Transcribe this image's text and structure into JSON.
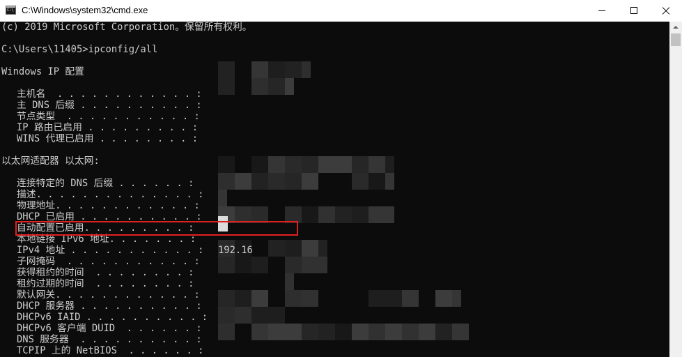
{
  "window": {
    "title": "C:\\Windows\\system32\\cmd.exe"
  },
  "console": {
    "copyright": "(c) 2019 Microsoft Corporation。保留所有权利。",
    "prompt": "C:\\Users\\11405>ipconfig/all",
    "ip_config_header": "Windows IP 配置",
    "global": [
      {
        "label": "主机名  . . . . . . . . . . . . :"
      },
      {
        "label": "主 DNS 后缀 . . . . . . . . . . :"
      },
      {
        "label": "节点类型  . . . . . . . . . . . :"
      },
      {
        "label": "IP 路由已启用 . . . . . . . . . :"
      },
      {
        "label": "WINS 代理已启用 . . . . . . . . :"
      }
    ],
    "adapter_header": "以太网适配器 以太网:",
    "adapter": [
      {
        "label": "连接特定的 DNS 后缀 . . . . . . :"
      },
      {
        "label": "描述. . . . . . . . . . . . . . :"
      },
      {
        "label": "物理地址. . . . . . . . . . . . :"
      },
      {
        "label": "DHCP 已启用 . . . . . . . . . . :"
      },
      {
        "label": "自动配置已启用. . . . . . . . . :"
      },
      {
        "label": "本地链接 IPv6 地址. . . . . . . :"
      },
      {
        "label": "IPv4 地址 . . . . . . . . . . . :"
      },
      {
        "label": "子网掩码  . . . . . . . . . . . :"
      },
      {
        "label": "获得租约的时间  . . . . . . . . :"
      },
      {
        "label": "租约过期的时间  . . . . . . . . :"
      },
      {
        "label": "默认网关. . . . . . . . . . . . :"
      },
      {
        "label": "DHCP 服务器 . . . . . . . . . . :"
      },
      {
        "label": "DHCPv6 IAID . . . . . . . . . . :"
      },
      {
        "label": "DHCPv6 客户端 DUID  . . . . . . :"
      },
      {
        "label": "DNS 服务器  . . . . . . . . . . :"
      },
      {
        "label": "TCPIP 上的 NetBIOS  . . . . . . :"
      }
    ],
    "ipv4_value": "192.16"
  },
  "colors": {
    "console_bg": "#0c0c0c",
    "console_text": "#cccccc",
    "highlight": "#e02020"
  }
}
